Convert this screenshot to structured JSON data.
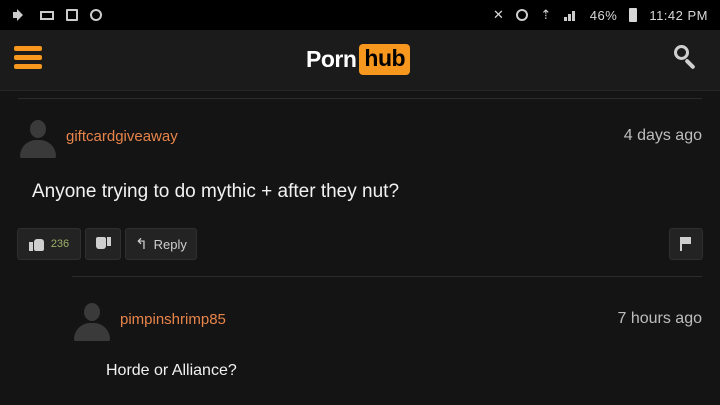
{
  "status_bar": {
    "left_icons": [
      "volume-icon",
      "mail-icon",
      "store-icon",
      "gear-icon"
    ],
    "right_icons": [
      "mute-icon",
      "alarm-icon",
      "wifi-icon",
      "signal-icon"
    ],
    "battery_percent": "46%",
    "time": "11:42 PM"
  },
  "header": {
    "logo_left": "Porn",
    "logo_right": "hub",
    "accent_color": "#f7971d"
  },
  "comments": [
    {
      "username": "giftcardgiveaway",
      "time_ago": "4 days ago",
      "text": "Anyone trying to do mythic + after they nut?",
      "likes": "236",
      "reply_label": "Reply"
    },
    {
      "username": "pimpinshrimp85",
      "time_ago": "7 hours ago",
      "text": "Horde or Alliance?"
    }
  ]
}
